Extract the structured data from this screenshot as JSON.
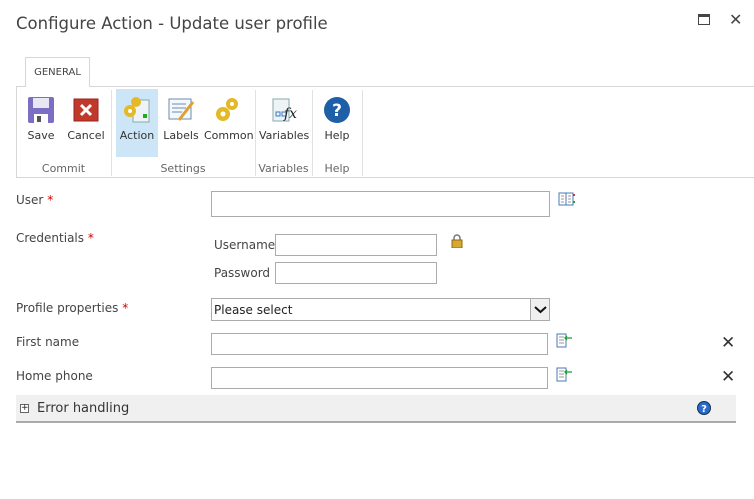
{
  "window": {
    "title": "Configure Action - Update user profile"
  },
  "tabs": [
    {
      "label": "GENERAL"
    }
  ],
  "ribbon": {
    "buttons": {
      "save": "Save",
      "cancel": "Cancel",
      "action": "Action",
      "labels": "Labels",
      "common": "Common",
      "variables": "Variables",
      "help": "Help"
    },
    "groups": {
      "commit": "Commit",
      "settings": "Settings",
      "variables": "Variables",
      "help": "Help"
    }
  },
  "form": {
    "user": {
      "label": "User",
      "required": "*",
      "value": ""
    },
    "credentials": {
      "label": "Credentials",
      "required": "*",
      "username_label": "Username",
      "password_label": "Password"
    },
    "profile_properties": {
      "label": "Profile properties",
      "required": "*",
      "selected": "Please select"
    },
    "first_name": {
      "label": "First name",
      "value": ""
    },
    "home_phone": {
      "label": "Home phone",
      "value": ""
    }
  },
  "error_handling": {
    "label": "Error handling",
    "toggle": "+"
  }
}
